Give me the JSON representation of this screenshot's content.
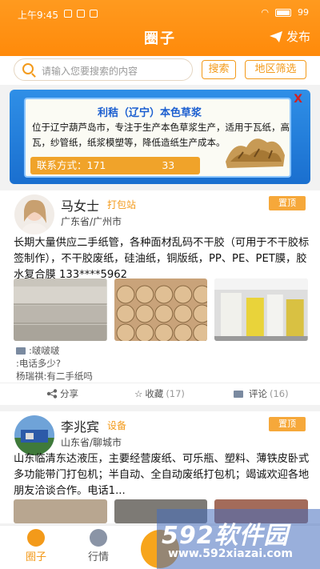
{
  "status": {
    "time": "上午9:45",
    "battery": "99"
  },
  "header": {
    "title": "圈子",
    "publish": "发布"
  },
  "search": {
    "placeholder": "请输入您要搜索的内容",
    "search_btn": "搜索",
    "region_btn": "地区筛选"
  },
  "banner": {
    "title": "利秸（辽宁）本色草浆",
    "desc": "位于辽宁葫芦岛市，专注于生产本色草浆生产，适用于瓦纸，高瓦，纱管纸，纸浆模塑等，降低造纸生产成本。",
    "contact_label": "联系方式：171",
    "contact_tail": "33",
    "close": "X"
  },
  "posts": [
    {
      "name": "马女士",
      "role": "打包站",
      "location": "广东省/广州市",
      "pin": "置顶",
      "content": "长期大量供应二手纸管，各种面材乱码不干胶（可用于不干胶标签制作），不干胶废纸，硅油纸，铜版纸，PP、PE、PET膜，胶水复合膜 133****5962",
      "comments": [
        ":啵啵啵",
        ":电话多少?",
        "杨瑞祺:有二手纸吗"
      ],
      "share": "分享",
      "fav": "收藏",
      "fav_count": "(17)",
      "comment": "评论",
      "comment_count": "(16)"
    },
    {
      "name": "李兆宾",
      "role": "设备",
      "location": "山东省/聊城市",
      "pin": "置顶",
      "content": "山东临清东达液压，主要经营废纸、可乐瓶、塑料、薄铁皮卧式多功能带门打包机；半自动、全自动废纸打包机；竭诚欢迎各地朋友洽谈合作。电话1..."
    }
  ],
  "nav": {
    "circle": "圈子",
    "market": "行情"
  },
  "watermark": {
    "big": "592软件园",
    "url": "www.592xiazai.com"
  },
  "colors": {
    "accent": "#ff8a0a",
    "orange_text": "#f39a1a"
  }
}
